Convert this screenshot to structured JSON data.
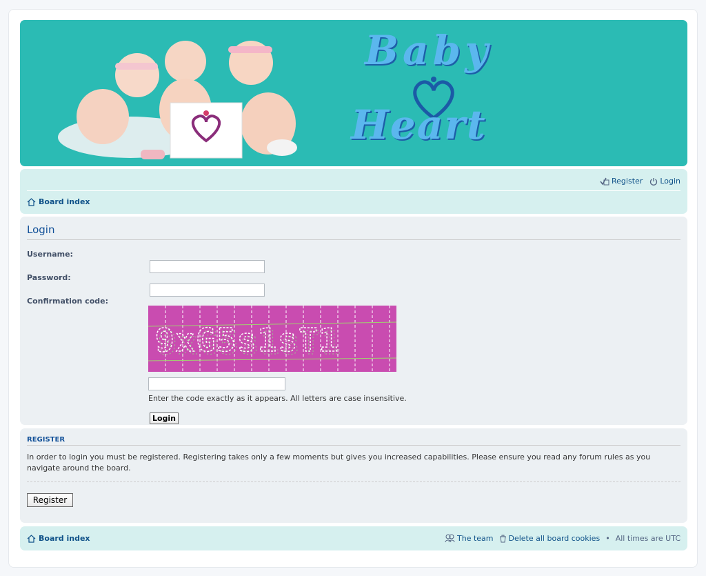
{
  "header": {
    "logo_text_line1": "Baby",
    "logo_text_line2": "Heart"
  },
  "top_nav": {
    "register_label": "Register",
    "login_label": "Login",
    "breadcrumb": "Board index"
  },
  "login_form": {
    "title": "Login",
    "username_label": "Username:",
    "username_value": "",
    "password_label": "Password:",
    "password_value": "",
    "confirm_label": "Confirmation code:",
    "captcha_text": "9xG5s1sT1",
    "code_value": "",
    "hint": "Enter the code exactly as it appears. All letters are case insensitive.",
    "submit_label": "Login"
  },
  "register_panel": {
    "title": "Register",
    "text": "In order to login you must be registered. Registering takes only a few moments but gives you increased capabilities. Please ensure you read any forum rules as you navigate around the board.",
    "button_label": "Register"
  },
  "footer_nav": {
    "breadcrumb": "Board index",
    "team_label": "The team",
    "cookies_label": "Delete all board cookies",
    "timezone_text": "All times are UTC"
  },
  "colors": {
    "header_bg": "#2bbbb4",
    "navbar_bg": "#d6f0ef",
    "panel_bg": "#ecf0f3",
    "link": "#105289",
    "captcha_bg": "#c94cb0"
  }
}
